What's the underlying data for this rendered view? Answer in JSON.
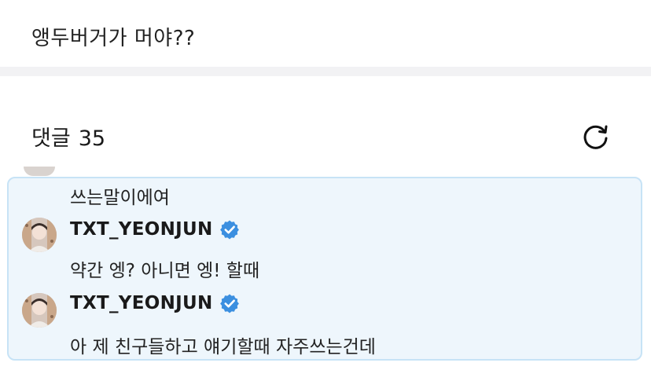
{
  "post": {
    "text": "앵두버거가 머야??"
  },
  "comments_header": {
    "label": "댓글",
    "count": "35"
  },
  "icons": {
    "refresh": "refresh-icon",
    "verified": "verified-badge-icon"
  },
  "colors": {
    "highlight_bg": "#eef6fc",
    "highlight_border": "#c7e3f6",
    "verified_blue": "#3b8fe0"
  },
  "thread": {
    "previous_reply_text": "쓰는말이에여",
    "replies": [
      {
        "author": "TXT_YEONJUN",
        "verified": true,
        "text": "약간 엥? 아니면 엥! 할때"
      },
      {
        "author": "TXT_YEONJUN",
        "verified": true,
        "text": "아 제 친구들하고 얘기할때 자주쓰는건데"
      }
    ]
  }
}
